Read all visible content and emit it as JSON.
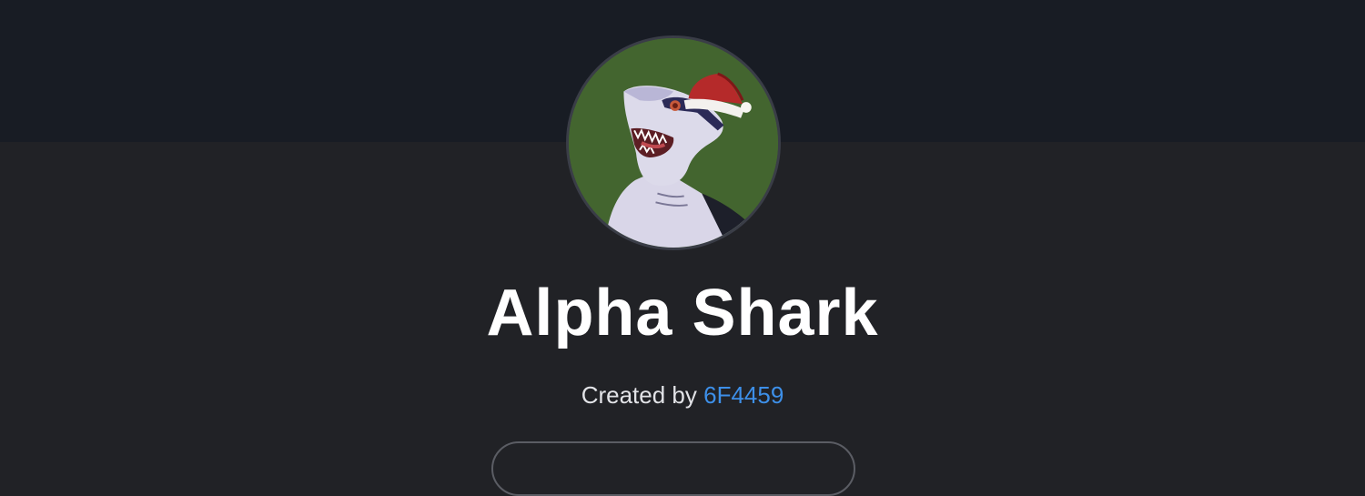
{
  "collection": {
    "name": "Alpha Shark",
    "created_by_label": "Created by",
    "creator": "6F4459",
    "avatar_icon": "shark-santa-hat-avatar"
  },
  "colors": {
    "banner": "#181c24",
    "background": "#212226",
    "avatar_bg": "#43652f",
    "link": "#3d8fe8"
  }
}
